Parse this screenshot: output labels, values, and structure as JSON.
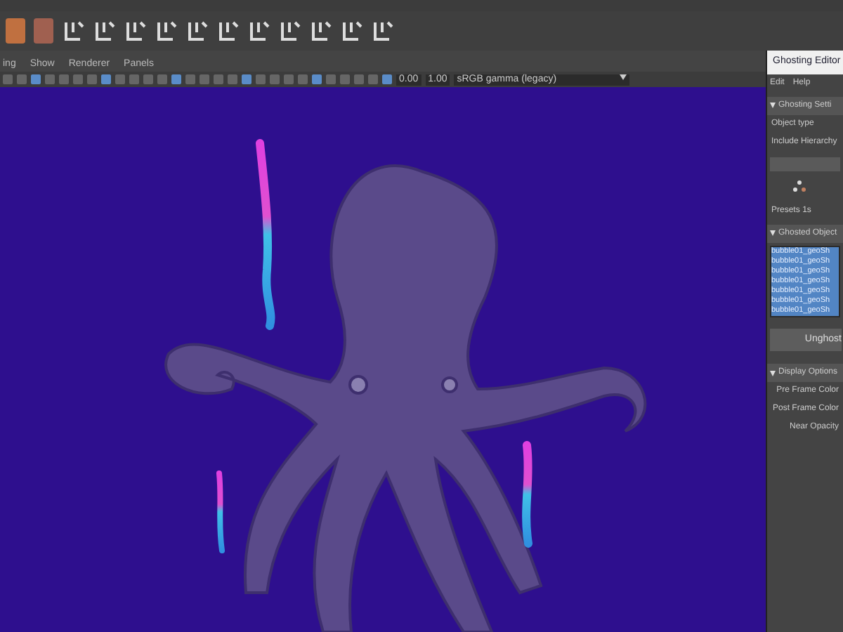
{
  "panel_menu": [
    "ing",
    "Show",
    "Renderer",
    "Panels"
  ],
  "panel_toolbar": {
    "exposure": "0.00",
    "gamma": "1.00",
    "color_space": "sRGB gamma (legacy)"
  },
  "ghosting_editor": {
    "title": "Ghosting Editor",
    "menu": [
      "Edit",
      "Help"
    ],
    "sections": [
      {
        "title": "Ghosting Setti",
        "expanded": true,
        "kind": "settings",
        "fields": [
          {
            "label": "Object type"
          },
          {
            "label": "Include Hierarchy"
          }
        ],
        "presets_label": "Presets",
        "presets_value": "1s"
      },
      {
        "title": "Ghosted Object",
        "expanded": true,
        "kind": "objects",
        "items": [
          {
            "label": "bubble01_geoSh",
            "selected": true
          },
          {
            "label": "bubble01_geoSh",
            "selected": true
          },
          {
            "label": "bubble01_geoSh",
            "selected": true
          },
          {
            "label": "bubble01_geoSh",
            "selected": true
          },
          {
            "label": "bubble01_geoSh",
            "selected": true
          },
          {
            "label": "bubble01_geoSh",
            "selected": true
          },
          {
            "label": "bubble01_geoSh",
            "selected": true
          }
        ],
        "button": "Unghost"
      },
      {
        "title": "Display Options",
        "expanded": true,
        "kind": "display",
        "fields": [
          {
            "label": "Pre Frame Color"
          },
          {
            "label": "Post Frame Color"
          },
          {
            "label": "Near Opacity"
          }
        ]
      }
    ]
  }
}
